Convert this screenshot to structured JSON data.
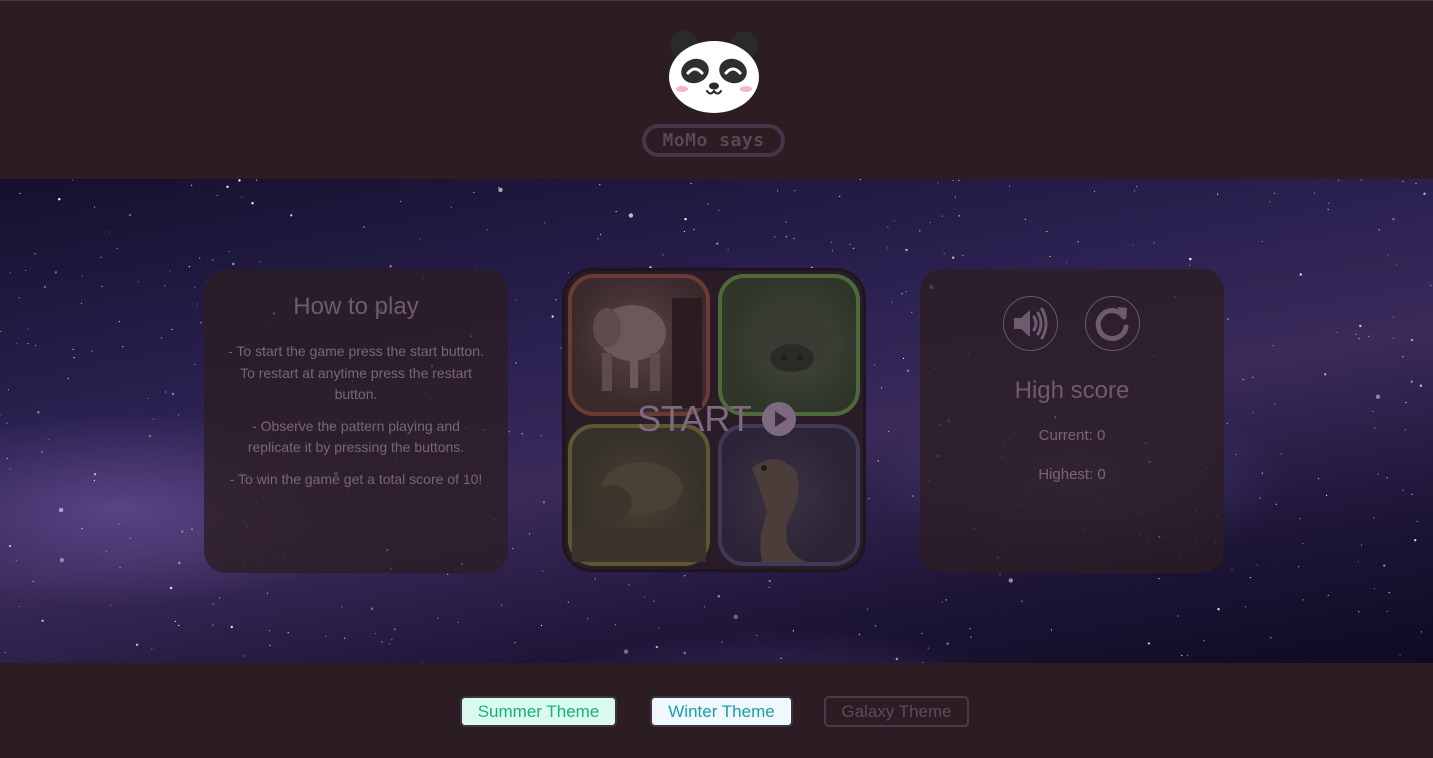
{
  "header": {
    "brand_label": "MoMo says",
    "logo_icon": "panda-icon"
  },
  "how_to_play": {
    "title": "How to play",
    "paragraphs": [
      "- To start the game press the start button. To restart at anytime press the restart button.",
      "- Observe the pattern playing and replicate it by pressing the buttons.",
      "- To win the game get a total score of 10!"
    ]
  },
  "board": {
    "start_label": "START",
    "start_icon": "play-icon",
    "tiles": [
      {
        "name": "elephant-tile",
        "border": "#6a3a35"
      },
      {
        "name": "hippo-tile",
        "border": "#4e6a3a"
      },
      {
        "name": "rhino-tile",
        "border": "#5e5732"
      },
      {
        "name": "seal-tile",
        "border": "#3f3856"
      }
    ]
  },
  "scores": {
    "sound_icon": "speaker-icon",
    "restart_icon": "restart-icon",
    "title": "High score",
    "current": "Current: 0",
    "highest": "Highest: 0"
  },
  "themes": {
    "summer": "Summer Theme",
    "winter": "Winter Theme",
    "galaxy": "Galaxy Theme"
  },
  "colors": {
    "background": "#2b1d22",
    "summer_text": "#18b07c",
    "winter_text": "#15a0ad",
    "galaxy_text": "#5b4a62"
  }
}
